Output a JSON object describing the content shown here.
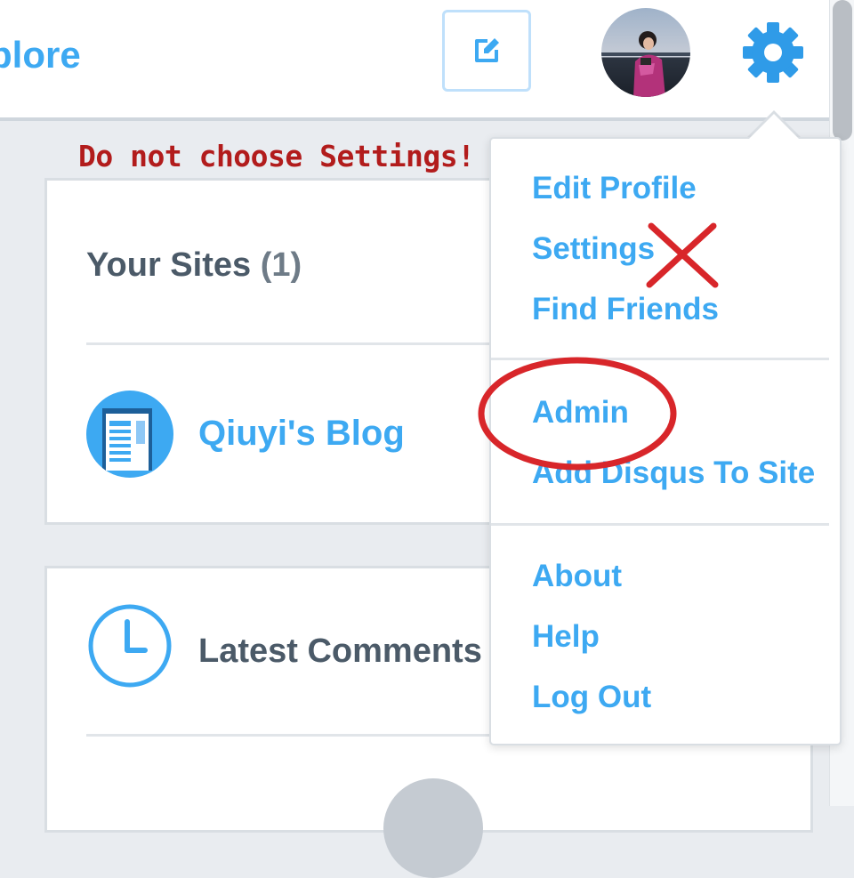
{
  "header": {
    "explore_label": "plore",
    "compose_icon": "edit-icon",
    "settings_icon": "gear-icon"
  },
  "annotation": {
    "text": "Do not choose Settings!",
    "color": "#b21c1c"
  },
  "sites_card": {
    "heading": "Your Sites",
    "count": "(1)",
    "site_name": "Qiuyi's Blog"
  },
  "comments_card": {
    "heading": "Latest Comments"
  },
  "dropdown": {
    "groups": [
      [
        "Edit Profile",
        "Settings",
        "Find Friends"
      ],
      [
        "Admin",
        "Add Disqus To Site"
      ],
      [
        "About",
        "Help",
        "Log Out"
      ]
    ],
    "items": {
      "edit_profile": "Edit Profile",
      "settings": "Settings",
      "find_friends": "Find Friends",
      "admin": "Admin",
      "add_disqus": "Add Disqus To Site",
      "about": "About",
      "help": "Help",
      "log_out": "Log Out"
    }
  },
  "colors": {
    "accent": "#3da9f2",
    "heading": "#4b5a68",
    "background": "#e9ecf0",
    "markup_red": "#d8262a"
  }
}
